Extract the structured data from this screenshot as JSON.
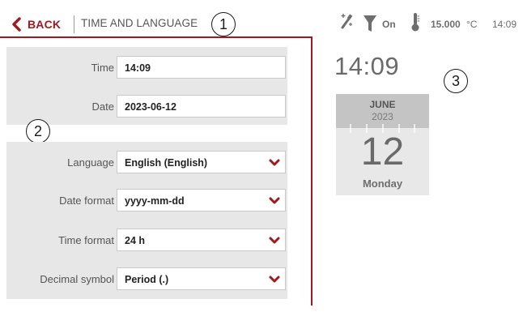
{
  "header": {
    "back_label": "BACK",
    "title": "TIME AND LANGUAGE",
    "status": {
      "filter_state": "On",
      "temperature_value": "15.000",
      "temperature_unit": "°C",
      "time": "14:09"
    }
  },
  "callouts": {
    "one": "1",
    "two": "2",
    "three": "3"
  },
  "time_date": {
    "time_label": "Time",
    "time_value": "14:09",
    "date_label": "Date",
    "date_value": "2023-06-12"
  },
  "settings": {
    "language_label": "Language",
    "language_value": "English (English)",
    "date_format_label": "Date format",
    "date_format_value": "yyyy-mm-dd",
    "time_format_label": "Time format",
    "time_format_value": "24 h",
    "decimal_label": "Decimal symbol",
    "decimal_value": "Period (.)"
  },
  "calendar": {
    "clock": "14:09",
    "month": "JUNE",
    "year": "2023",
    "day": "12",
    "weekday": "Monday"
  },
  "icons": {
    "back": "chevron-left-icon",
    "wand": "magic-wand-icon",
    "filter": "funnel-icon",
    "thermometer": "thermometer-icon",
    "dropdown": "chevron-down-icon"
  },
  "colors": {
    "accent": "#a3171e",
    "panel": "#e7e7e7",
    "calendar_header": "#c4c4c4"
  }
}
